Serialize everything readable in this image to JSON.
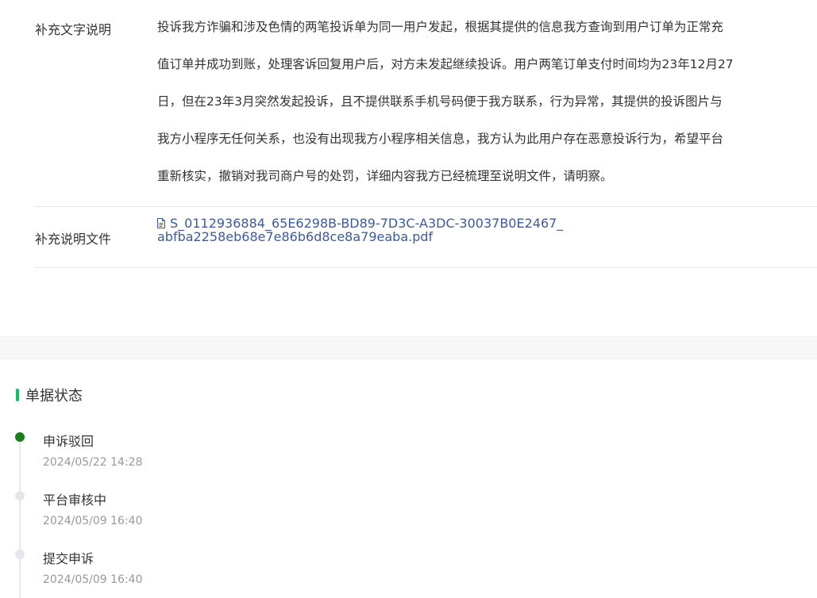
{
  "supplement": {
    "text_label": "补充文字说明",
    "text_lines": [
      "投诉我方诈骗和涉及色情的两笔投诉单为同一用户发起，根据其提供的信息我方查询到用户订单为正常充",
      "值订单并成功到账，处理客诉回复用户后，对方未发起继续投诉。用户两笔订单支付时间均为23年12月27",
      "日，但在23年3月突然发起投诉，且不提供联系手机号码便于我方联系，行为异常，其提供的投诉图片与",
      "我方小程序无任何关系，也没有出现我方小程序相关信息，我方认为此用户存在恶意投诉行为，希望平台",
      "重新核实，撤销对我司商户号的处罚，详细内容我方已经梳理至说明文件，请明察。"
    ],
    "file_label": "补充说明文件",
    "file_name": "S_0112936884_65E6298B-BD89-7D3C-A3DC-30037B0E2467_abfba2258eb68e7e86b6d8ce8a79eaba.pdf",
    "file_icon": "document-icon"
  },
  "status_section": {
    "title": "单据状态",
    "accent_color": "#07c160",
    "timeline": [
      {
        "status": "申诉驳回",
        "time": "2024/05/22 14:28",
        "active": true,
        "dot_color": "#1a7f1a"
      },
      {
        "status": "平台审核中",
        "time": "2024/05/09 16:40",
        "active": false,
        "dot_color": "#e3e6eb"
      },
      {
        "status": "提交申诉",
        "time": "2024/05/09 16:40",
        "active": false,
        "dot_color": "#e3e6eb"
      }
    ]
  }
}
